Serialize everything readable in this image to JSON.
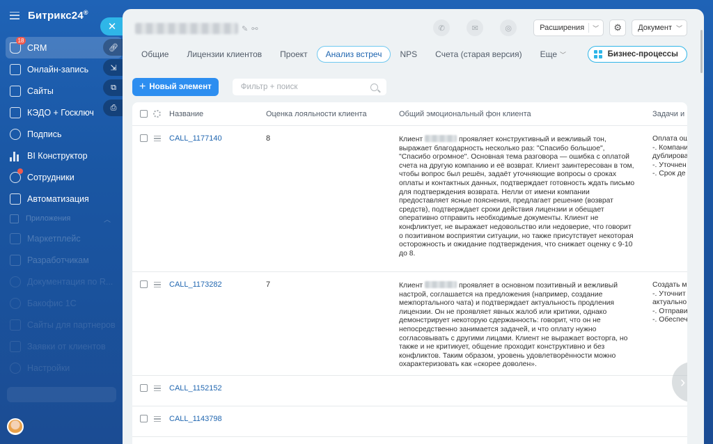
{
  "app": {
    "logo": "Битрикс24",
    "logo_mark": "®"
  },
  "sidebar": {
    "items": [
      {
        "label": "CRM",
        "badge": "18",
        "icon": "funnel-icon"
      },
      {
        "label": "Онлайн-запись",
        "icon": "calendar-icon"
      },
      {
        "label": "Сайты",
        "icon": "window-icon"
      },
      {
        "label": "КЭДО + Госключ",
        "icon": "document-icon"
      },
      {
        "label": "Подпись",
        "icon": "pen-icon"
      },
      {
        "label": "BI Конструктор",
        "icon": "chart-icon"
      },
      {
        "label": "Сотрудники",
        "badge": "dot",
        "icon": "users-icon"
      },
      {
        "label": "Автоматизация",
        "icon": "robot-icon"
      }
    ],
    "group": {
      "label": "Приложения"
    },
    "group_items": [
      {
        "label": "Маркетплейс"
      },
      {
        "label": "Разработчикам"
      },
      {
        "label": "Документация по R..."
      },
      {
        "label": "Бакофис 1С"
      },
      {
        "label": "Сайты для партнеров"
      },
      {
        "label": "Заявки от клиентов"
      },
      {
        "label": "Настройки"
      }
    ]
  },
  "side_actions": {
    "close": "✕",
    "icons": [
      "link-icon",
      "collapse-icon",
      "open-new-window-icon",
      "print-icon"
    ]
  },
  "header": {
    "title": "",
    "extensions_label": "Расширения",
    "document_label": "Документ",
    "icons": [
      "phone-icon",
      "mail-icon",
      "chat-icon",
      "settings-icon"
    ]
  },
  "tabs": [
    {
      "label": "Общие"
    },
    {
      "label": "Лицензии клиентов"
    },
    {
      "label": "Проект"
    },
    {
      "label": "Анализ встреч",
      "active": true
    },
    {
      "label": "NPS"
    },
    {
      "label": "Счета (старая версия)"
    },
    {
      "label": "Еще"
    }
  ],
  "business_processes_label": "Бизнес-процессы",
  "toolbar": {
    "new_label": "Новый элемент",
    "filter_placeholder": "Фильтр + поиск"
  },
  "table": {
    "columns": [
      "Название",
      "Оценка лояльности клиента",
      "Общий эмоциональный фон клиента",
      "Задачи и р"
    ],
    "rows": [
      {
        "name": "CALL_1177140",
        "score": "8",
        "emotion_pre": "Клиент",
        "emotion_post": "проявляет конструктивный и вежливый тон, выражает благодарность несколько раз: \"Спасибо большое\", \"Спасибо огромное\". Основная тема разговора — ошибка с оплатой счета на другую компанию и её возврат. Клиент заинтересован в том, чтобы вопрос был решён, задаёт уточняющие вопросы о сроках оплаты и контактных данных, подтверждает готовность ждать письмо для подтверждения возврата. Нелли от имени компании предоставляет ясные пояснения, предлагает решение (возврат средств), подтверждает сроки действия лицензии и обещает оперативно отправить необходимые документы. Клиент не конфликтует, не выражает недовольство или недоверие, что говорит о позитивном восприятии ситуации, но также присутствует некоторая осторожность и ожидание подтверждения, что снижает оценку с 9-10 до 8.",
        "tasks": [
          "Оплата ош",
          "-. Компани",
          "дублирова",
          "-. Уточнен",
          "-. Срок де"
        ]
      },
      {
        "name": "CALL_1173282",
        "score": "7",
        "emotion_pre": "Клиент",
        "emotion_post": "проявляет в основном позитивный и вежливый настрой, соглашается на предложения (например, создание межпортального чата) и подтверждает актуальность продления лицензии. Он не проявляет явных жалоб или критики, однако демонстрирует некоторую сдержанность: говорит, что он не непосредственно занимается задачей, и что оплату нужно согласовывать с другими лицами. Клиент не выражает восторга, но также и не критикует, общение проходит конструктивно и без конфликтов. Таким образом, уровень удовлетворённости можно охарактеризовать как «скорее доволен».",
        "tasks": [
          "Создать м",
          "-. Уточнит",
          "актуально",
          "-. Отправи",
          "-. Обеспеч"
        ]
      },
      {
        "name": "CALL_1152152",
        "score": "",
        "emotion_pre": "",
        "emotion_post": "",
        "tasks": []
      },
      {
        "name": "CALL_1143798",
        "score": "",
        "emotion_pre": "",
        "emotion_post": "",
        "tasks": []
      }
    ]
  }
}
